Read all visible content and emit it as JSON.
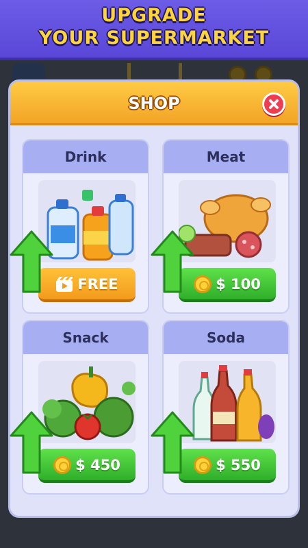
{
  "banner": {
    "line1": "UPGRADE",
    "line2": "YOUR SUPERMARKET"
  },
  "shop": {
    "title": "SHOP",
    "items": [
      {
        "name": "Drink",
        "price_label": "FREE",
        "button_style": "orange",
        "icon": "video-ad-icon"
      },
      {
        "name": "Meat",
        "price_label": "$ 100",
        "button_style": "green",
        "icon": "coin-icon"
      },
      {
        "name": "Snack",
        "price_label": "$ 450",
        "button_style": "green",
        "icon": "coin-icon"
      },
      {
        "name": "Soda",
        "price_label": "$ 550",
        "button_style": "green",
        "icon": "coin-icon"
      }
    ]
  },
  "colors": {
    "banner": "#5a47d8",
    "banner_text": "#ffd33a",
    "header": "#f7b12f",
    "card_head": "#a7aff2",
    "green_button": "#3fc235",
    "orange_button": "#f7aa26",
    "close_button": "#ef3d52"
  }
}
